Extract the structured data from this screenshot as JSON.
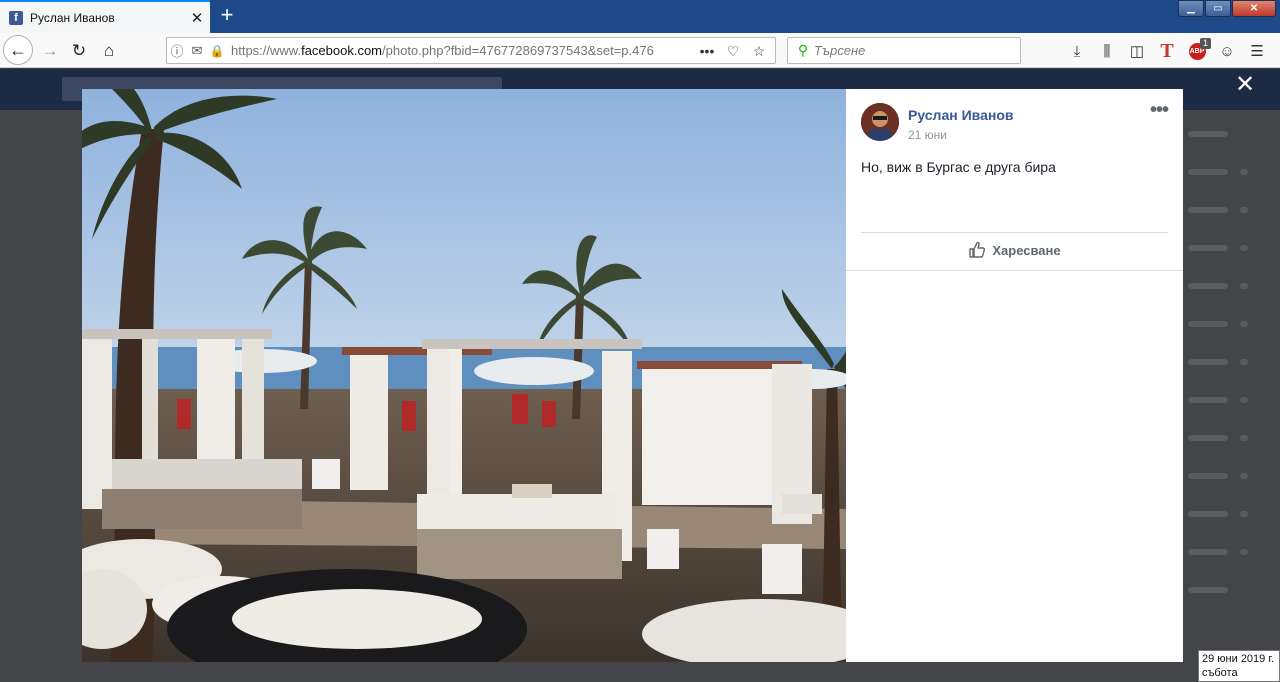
{
  "browser": {
    "tab": {
      "title": "Руслан Иванов",
      "favicon": "f"
    },
    "newtab": "+",
    "window_buttons": {
      "minimize": "▁",
      "maximize": "▭",
      "close": "✕"
    },
    "nav": {
      "back": "←",
      "forward": "→",
      "reload": "↻",
      "home": "⌂"
    },
    "url": {
      "prefix": "https://www.",
      "domain": "facebook.com",
      "rest": "/photo.php?fbid=476772869737543&set=p.476"
    },
    "url_actions": {
      "more": "•••",
      "pocket": "♡",
      "bookmark": "☆"
    },
    "search": {
      "placeholder": "Търсене"
    },
    "tools": {
      "download": "⤓",
      "library": "⫼",
      "sidebar": "◫",
      "t_ext": "T",
      "abp": "ABP",
      "abp_badge": "1",
      "account": "☺",
      "menu": "☰"
    }
  },
  "viewer": {
    "close": "✕",
    "author": "Руслан Иванов",
    "date": "21 юни",
    "more": "•••",
    "post_text": "Но, виж в Бургас е друга бира",
    "like_label": "Харесване"
  },
  "tooltip": {
    "line1": "29 юни 2019 г.",
    "line2": "събота"
  },
  "icons": [
    "facebook-favicon-icon",
    "close-tab-icon",
    "new-tab-icon",
    "back-icon",
    "forward-icon",
    "reload-icon",
    "home-icon",
    "info-icon",
    "permissions-icon",
    "lock-icon",
    "page-actions-icon",
    "pocket-icon",
    "bookmark-star-icon",
    "search-icon",
    "download-icon",
    "library-icon",
    "sidebar-icon",
    "text-extension-icon",
    "adblock-icon",
    "account-icon",
    "hamburger-menu-icon",
    "close-viewer-icon",
    "more-options-icon",
    "thumbs-up-icon"
  ]
}
